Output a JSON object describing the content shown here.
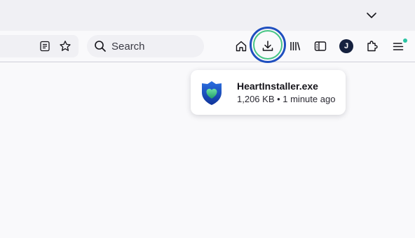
{
  "toolbar": {
    "search_label": "Search",
    "avatar_initial": "J"
  },
  "icons": {
    "tabs_menu": "chevron-down-icon",
    "reader_view": "reader-view-icon",
    "bookmark": "star-icon",
    "search": "search-icon",
    "home": "home-icon",
    "downloads": "download-icon",
    "library": "library-icon",
    "sidebar": "sidebar-icon",
    "extensions": "puzzle-icon",
    "app_menu": "hamburger-menu-icon",
    "file": "shield-heart-icon"
  },
  "colors": {
    "highlight_outer": "#1f4fbf",
    "highlight_inner": "#47c585",
    "notification_dot": "#2ac3a2"
  },
  "downloads_panel": {
    "items": [
      {
        "filename": "HeartInstaller.exe",
        "status": "1,206 KB • 1 minute ago"
      }
    ]
  }
}
